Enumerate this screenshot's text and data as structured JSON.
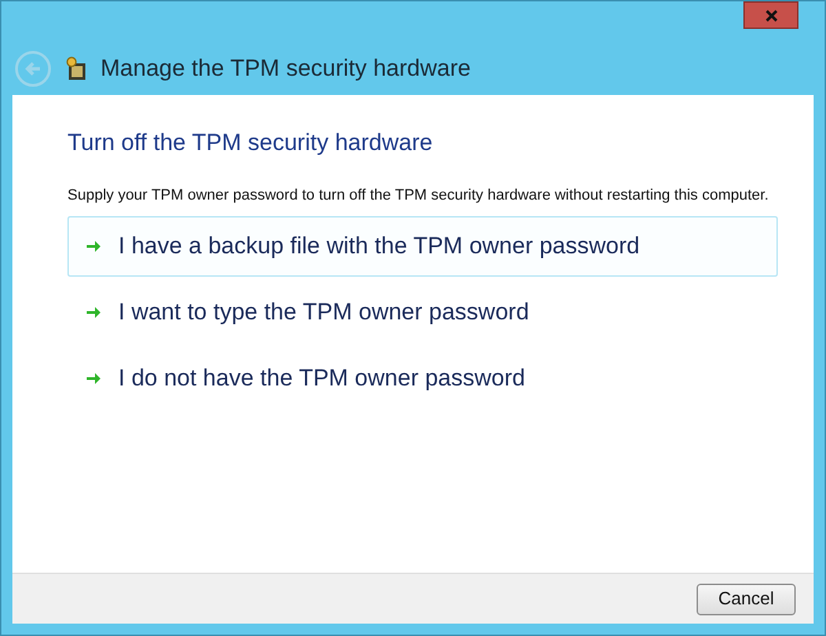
{
  "window": {
    "title": "Manage the TPM security hardware",
    "back_disabled": true
  },
  "heading": "Turn off the TPM security hardware",
  "description": "Supply your TPM owner password to turn off the TPM security hardware without restarting this computer.",
  "options": [
    {
      "label": "I have a backup file with the TPM owner password",
      "selected": true
    },
    {
      "label": "I want to type the TPM owner password",
      "selected": false
    },
    {
      "label": "I do not have the TPM owner password",
      "selected": false
    }
  ],
  "buttons": [
    "Cancel"
  ]
}
